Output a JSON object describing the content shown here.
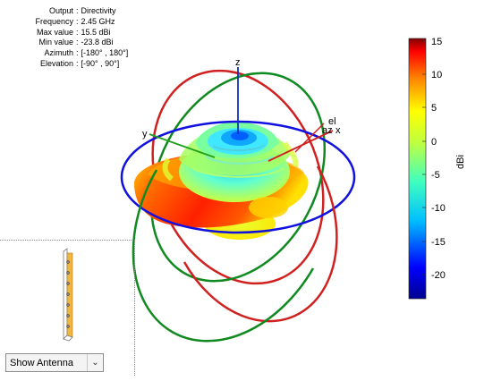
{
  "info": [
    {
      "key": "Output",
      "value": "Directivity"
    },
    {
      "key": "Frequency",
      "value": "2.45 GHz"
    },
    {
      "key": "Max value",
      "value": "15.5 dBi"
    },
    {
      "key": "Min value",
      "value": "-23.8 dBi"
    },
    {
      "key": "Azimuth",
      "value": "[-180° , 180°]"
    },
    {
      "key": "Elevation",
      "value": "[-90° , 90°]"
    }
  ],
  "axes": {
    "x": "x",
    "y": "y",
    "z": "z",
    "az": "az",
    "el": "el"
  },
  "colorbar": {
    "label": "dBi",
    "ticks": [
      "15",
      "10",
      "5",
      "0",
      "-5",
      "-10",
      "-15",
      "-20"
    ],
    "range": [
      -23.8,
      15.5
    ]
  },
  "dropdown": {
    "selected": "Show Antenna",
    "icon": "chevron-down-icon"
  },
  "colors": {
    "az_circle": "#1010e0",
    "el_circle_1": "#d02020",
    "el_circle_2": "#108a20"
  }
}
